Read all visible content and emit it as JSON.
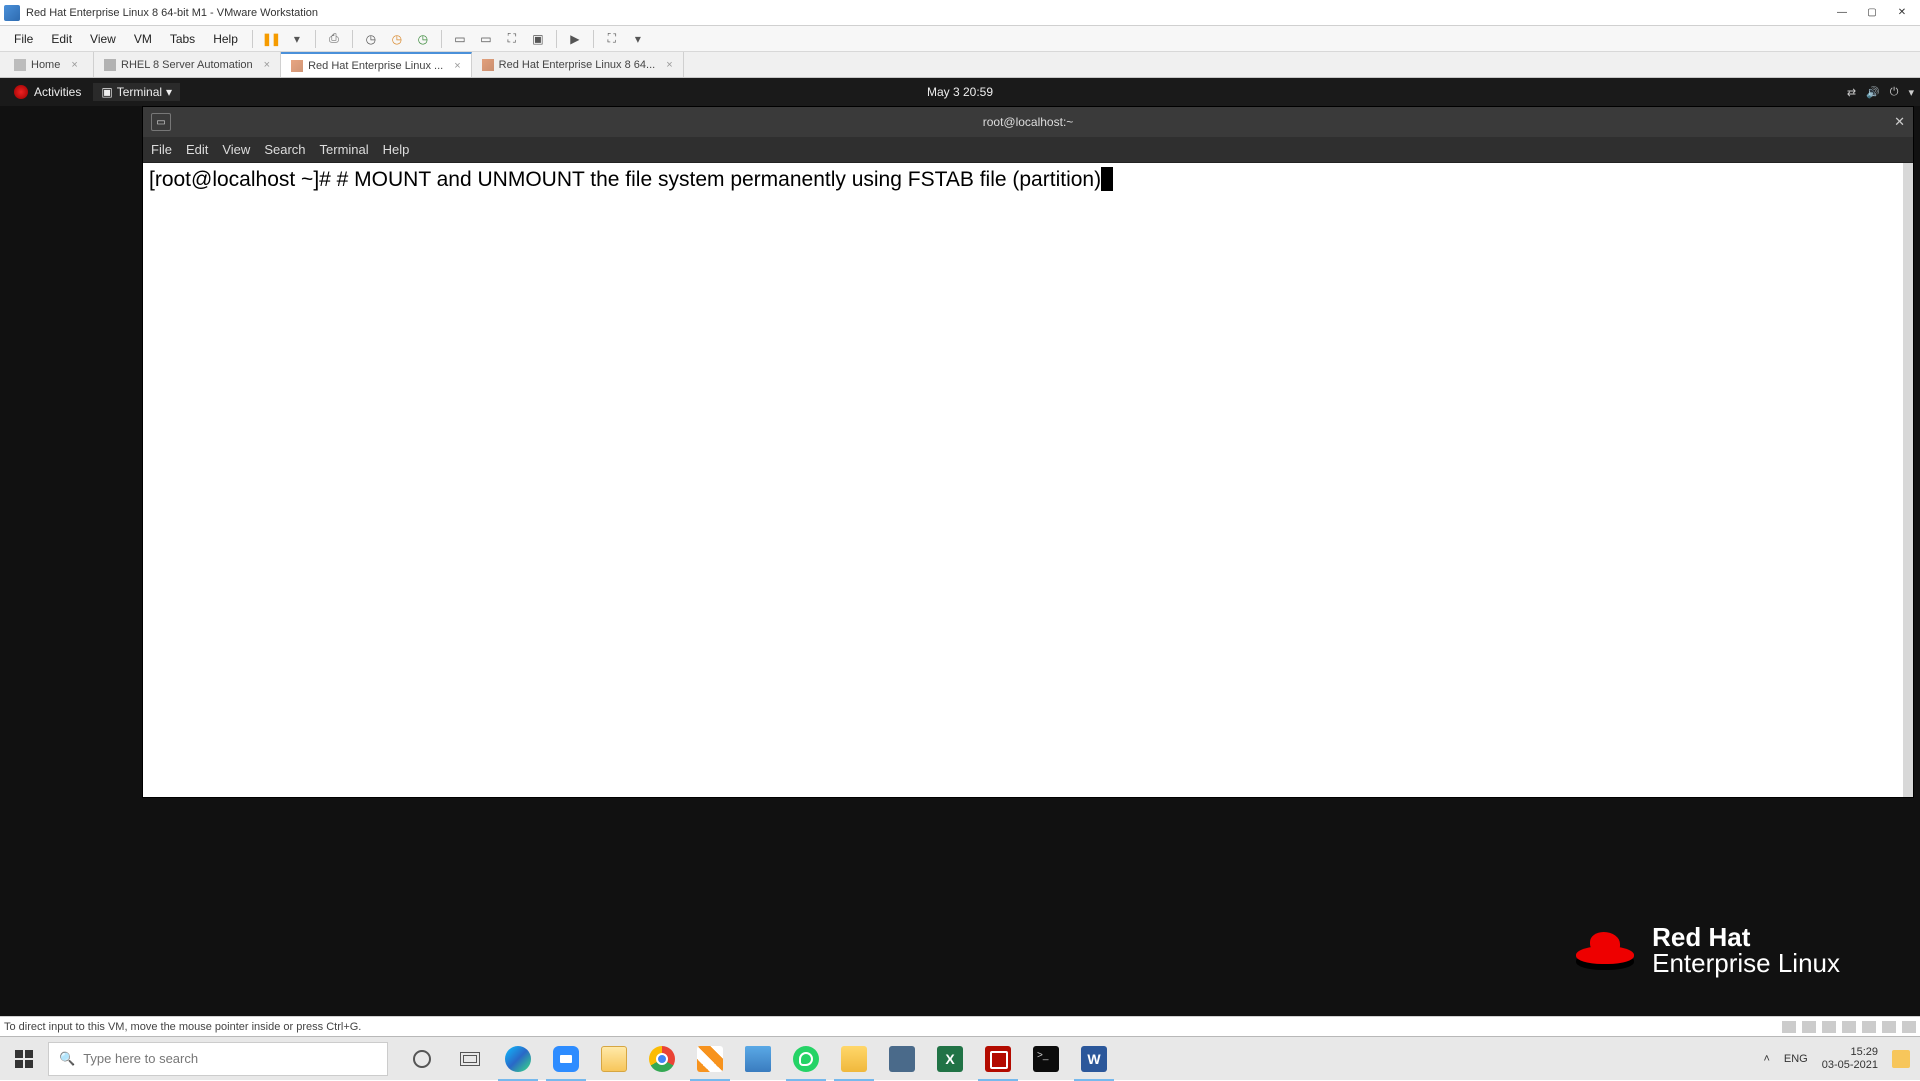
{
  "vmware": {
    "title": "Red Hat Enterprise Linux 8 64-bit M1 - VMware Workstation",
    "menu": {
      "file": "File",
      "edit": "Edit",
      "view": "View",
      "vm": "VM",
      "tabs": "Tabs",
      "help": "Help"
    },
    "tabs": [
      {
        "label": "Home"
      },
      {
        "label": "RHEL 8 Server Automation"
      },
      {
        "label": "Red Hat Enterprise Linux ..."
      },
      {
        "label": "Red Hat Enterprise Linux 8 64..."
      }
    ],
    "statusbar": "To direct input to this VM, move the mouse pointer inside or press Ctrl+G."
  },
  "gnome": {
    "activities": "Activities",
    "terminal_indicator": "Terminal",
    "clock": "May 3  20:59"
  },
  "terminal": {
    "window_title": "root@localhost:~",
    "menu": {
      "file": "File",
      "edit": "Edit",
      "view": "View",
      "search": "Search",
      "terminal": "Terminal",
      "help": "Help"
    },
    "prompt": "[root@localhost ~]# ",
    "command": "# MOUNT and UNMOUNT the file system permanently using FSTAB file (partition)"
  },
  "rhel_logo": {
    "line1": "Red Hat",
    "line2": "Enterprise Linux"
  },
  "windows": {
    "search_placeholder": "Type here to search",
    "lang": "ENG",
    "time": "15:29",
    "date": "03-05-2021"
  }
}
